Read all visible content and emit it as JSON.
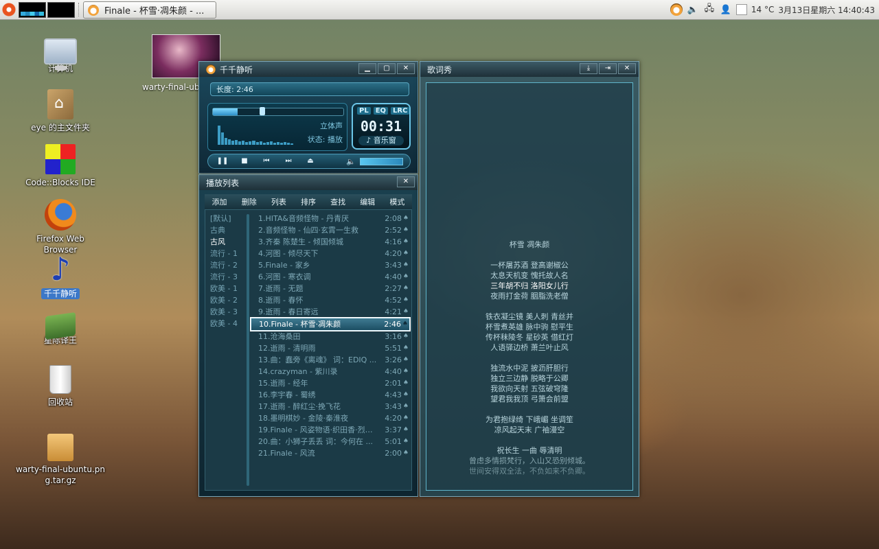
{
  "panel": {
    "taskbar_label": "Finale - 杯雪·凋朱颜 - ...",
    "tray": {
      "temperature": "14 °C",
      "datetime": "3月13日星期六 14:40:43"
    }
  },
  "desktop_icons": [
    {
      "label": "计算机",
      "icon": "computer-icon"
    },
    {
      "label": "eye 的主文件夹",
      "icon": "home-folder-icon"
    },
    {
      "label": "Code::Blocks IDE",
      "icon": "codeblocks-icon"
    },
    {
      "label": "Firefox Web Browser",
      "icon": "firefox-icon"
    },
    {
      "label": "千千静听",
      "icon": "music-note-icon"
    },
    {
      "label": "星际译王",
      "icon": "dictionary-books-icon"
    },
    {
      "label": "回收站",
      "icon": "trash-icon"
    },
    {
      "label": "warty-final-ubuntu.png.tar.gz",
      "icon": "archive-icon"
    }
  ],
  "thumbnail_label": "warty-final-ubuntu",
  "player": {
    "title": "千千静听",
    "length": "长度: 2:46",
    "stereo": "立体声",
    "status": "状态: 播放",
    "tabs": [
      "PL",
      "EQ",
      "LRC"
    ],
    "time": "00:31",
    "music_window": "♪ 音乐窗",
    "progress": 0.19,
    "volume": 0.9
  },
  "playlist": {
    "title": "播放列表",
    "menu": [
      "添加",
      "删除",
      "列表",
      "排序",
      "查找",
      "编辑",
      "模式"
    ],
    "groups": [
      "[默认]",
      "古典",
      "古风",
      "流行 - 1",
      "流行 - 2",
      "流行 - 3",
      "欧美 - 1",
      "欧美 - 2",
      "欧美 - 3",
      "欧美 - 4"
    ],
    "active_group": 2,
    "current_index": 9,
    "songs": [
      {
        "title": "1.HITA&音频怪物 - 丹青厌",
        "duration": "2:08"
      },
      {
        "title": "2.音频怪物 - 仙四·玄霄一生救",
        "duration": "2:52"
      },
      {
        "title": "3.齐秦 陈楚生 - 倾国倾城",
        "duration": "4:16"
      },
      {
        "title": "4.河图 - 倾尽天下",
        "duration": "4:20"
      },
      {
        "title": "5.Finale - 家乡",
        "duration": "3:43"
      },
      {
        "title": "6.河图 - 寒衣调",
        "duration": "4:40"
      },
      {
        "title": "7.逝雨 - 无题",
        "duration": "2:27"
      },
      {
        "title": "8.逝雨 - 春怀",
        "duration": "4:52"
      },
      {
        "title": "9.逝雨 - 春日寄远",
        "duration": "4:21"
      },
      {
        "title": "10.Finale - 杯雪·凋朱颜",
        "duration": "2:46"
      },
      {
        "title": "11.沧海桑田",
        "duration": "3:16"
      },
      {
        "title": "12.逝雨 - 清明雨",
        "duration": "5:51"
      },
      {
        "title": "13.曲：蠢旁《离魂》 词：EDIQ ...",
        "duration": "3:26"
      },
      {
        "title": "14.crazyman - 紫川录",
        "duration": "4:40"
      },
      {
        "title": "15.逝雨 - 经年",
        "duration": "2:01"
      },
      {
        "title": "16.李宇春 - 蜀绣",
        "duration": "4:43"
      },
      {
        "title": "17.逝雨 - 醉红尘·挽飞花",
        "duration": "3:43"
      },
      {
        "title": "18.墨明棋妙 - 金陵·秦淮夜",
        "duration": "4:20"
      },
      {
        "title": "19.Finale - 风姿物语·织田香·烈焰...",
        "duration": "3:37"
      },
      {
        "title": "20.曲：小狮子丢丢 词：今何在 ...",
        "duration": "5:01"
      },
      {
        "title": "21.Finale - 风流",
        "duration": "2:00"
      }
    ]
  },
  "lyrics": {
    "title": "歌词秀",
    "current_line": 4,
    "lines": [
      "杯雪 凋朱颜",
      "",
      "一杯屠苏酒 登高谢椒公",
      "太息天机变 愧托故人名",
      "三年胡不归 洛阳女儿行",
      "夜雨打金荷 胭脂洗老僧",
      "",
      "铁衣凝尘镜 美人刺 青丝并",
      "杯雪煮英雄 脉中驹 慰平生",
      "传杯秣陵冬 星砂英 借红灯",
      "人语驿边桥 萧兰叶止风",
      "",
      "独流水中泥 披沥肝胆行",
      "独立三边静 脱略于公卿",
      "我欲向天射 五弦破穹隆",
      "望君我我顶 弓箫会前盟",
      "",
      "为君抱绿绮 下峨嵋 坐调笙",
      "凉风起天末 广袖漫空",
      "",
      "祝长生 一曲 辱清明",
      "曾虑多情损梵行，入山又恐别倾城。",
      "世间安得双全法，不负如来不负卿。"
    ]
  }
}
